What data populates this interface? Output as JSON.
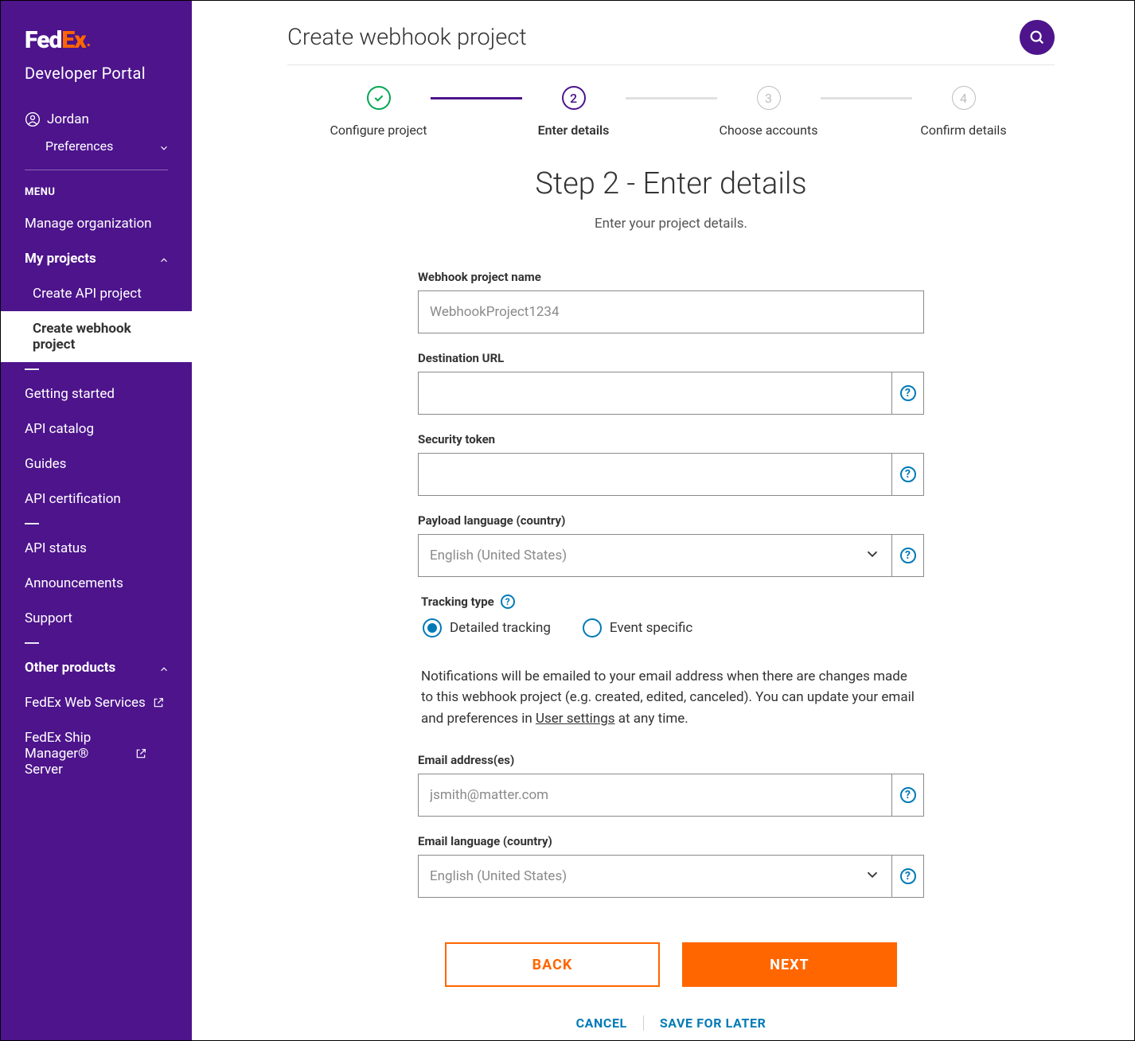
{
  "brand": {
    "fed": "Fed",
    "ex": "Ex",
    "portal": "Developer Portal"
  },
  "user": {
    "name": "Jordan",
    "preferences": "Preferences"
  },
  "menu": {
    "label": "MENU",
    "manage_org": "Manage organization",
    "my_projects": "My projects",
    "create_api": "Create API project",
    "create_webhook": "Create webhook project",
    "getting_started": "Getting started",
    "api_catalog": "API catalog",
    "guides": "Guides",
    "api_cert": "API certification",
    "api_status": "API status",
    "announcements": "Announcements",
    "support": "Support",
    "other_products": "Other products",
    "fedex_ws": "FedEx Web Services",
    "fedex_sms": "FedEx Ship Manager® Server"
  },
  "header": {
    "title": "Create webhook project"
  },
  "stepper": {
    "steps": [
      {
        "num": "✓",
        "label": "Configure project",
        "state": "done"
      },
      {
        "num": "2",
        "label": "Enter details",
        "state": "active"
      },
      {
        "num": "3",
        "label": "Choose accounts",
        "state": "future"
      },
      {
        "num": "4",
        "label": "Confirm details",
        "state": "future"
      }
    ]
  },
  "step": {
    "heading": "Step 2 - Enter details",
    "subheading": "Enter your project details."
  },
  "form": {
    "project_name": {
      "label": "Webhook project name",
      "placeholder": "WebhookProject1234",
      "value": ""
    },
    "destination_url": {
      "label": "Destination URL",
      "value": ""
    },
    "security_token": {
      "label": "Security token",
      "value": ""
    },
    "payload_lang": {
      "label": "Payload language (country)",
      "value": "English (United States)"
    },
    "tracking_type": {
      "label": "Tracking type",
      "options": {
        "detailed": "Detailed tracking",
        "event": "Event specific"
      },
      "selected": "detailed"
    },
    "note_pre": "Notifications will be emailed to your email address when there are changes made to this webhook project (e.g. created, edited, canceled). You can update your email and preferences in ",
    "note_link": "User settings",
    "note_post": " at any time.",
    "email_addresses": {
      "label": "Email address(es)",
      "placeholder": "jsmith@matter.com",
      "value": ""
    },
    "email_lang": {
      "label": "Email language (country)",
      "value": "English (United States)"
    }
  },
  "actions": {
    "back": "BACK",
    "next": "NEXT",
    "cancel": "CANCEL",
    "save": "SAVE FOR LATER"
  }
}
